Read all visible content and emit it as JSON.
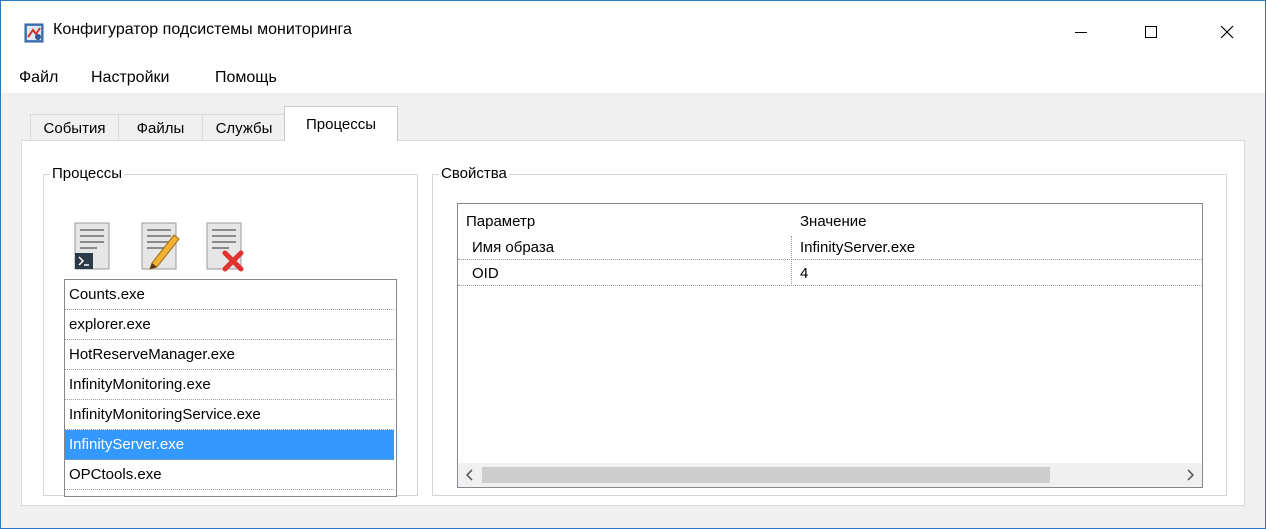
{
  "window": {
    "title": "Конфигуратор подсистемы мониторинга"
  },
  "menu": [
    "Файл",
    "Настройки",
    "Помощь"
  ],
  "tabs": [
    {
      "label": "События",
      "active": false
    },
    {
      "label": "Файлы",
      "active": false
    },
    {
      "label": "Службы",
      "active": false
    },
    {
      "label": "Процессы",
      "active": true
    }
  ],
  "processes_group": {
    "label": "Процессы",
    "toolbar": {
      "add_icon": "add-process-icon",
      "edit_icon": "edit-process-icon",
      "delete_icon": "delete-process-icon"
    },
    "items": [
      "Counts.exe",
      "explorer.exe",
      "HotReserveManager.exe",
      "InfinityMonitoring.exe",
      "InfinityMonitoringService.exe",
      "InfinityServer.exe",
      "OPCtools.exe"
    ],
    "selected_index": 5
  },
  "properties_group": {
    "label": "Свойства",
    "columns": [
      "Параметр",
      "Значение"
    ],
    "rows": [
      {
        "param": "Имя образа",
        "value": "InfinityServer.exe"
      },
      {
        "param": "OID",
        "value": "4"
      }
    ]
  },
  "colors": {
    "selection": "#3399ff",
    "window_border": "#2b78c5",
    "delete_icon": "#e0322f"
  }
}
